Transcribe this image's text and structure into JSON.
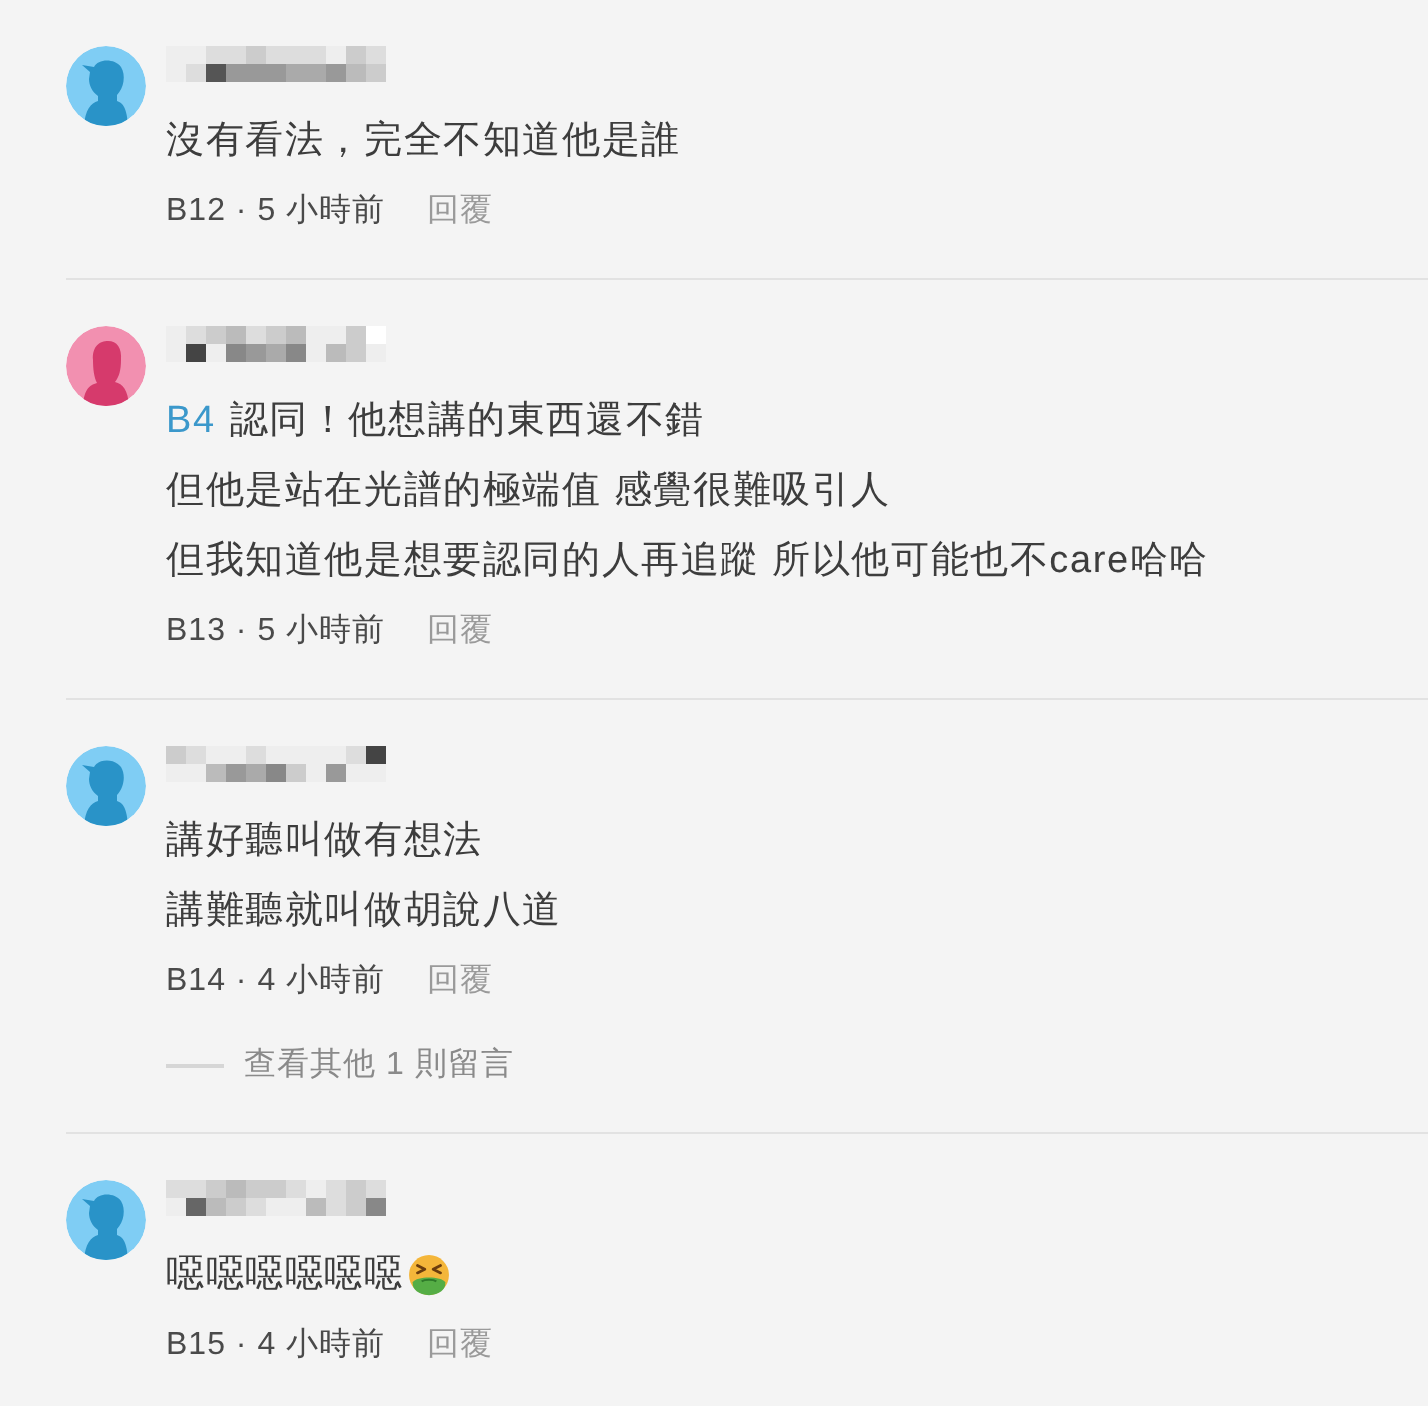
{
  "comments": [
    {
      "avatar": {
        "kind": "short-hair"
      },
      "lines": [
        "沒有看法，完全不知道他是誰"
      ],
      "meta": "B12 · 5 小時前",
      "reply": "回覆"
    },
    {
      "avatar": {
        "kind": "long-hair"
      },
      "mention": "B4",
      "lines": [
        "認同！他想講的東西還不錯",
        "但他是站在光譜的極端值 感覺很難吸引人",
        "但我知道他是想要認同的人再追蹤 所以他可能也不care哈哈"
      ],
      "meta": "B13 · 5 小時前",
      "reply": "回覆"
    },
    {
      "avatar": {
        "kind": "short-hair"
      },
      "lines": [
        "講好聽叫做有想法",
        "講難聽就叫做胡說八道"
      ],
      "meta": "B14 · 4 小時前",
      "reply": "回覆",
      "more_replies": "查看其他 1 則留言"
    },
    {
      "avatar": {
        "kind": "short-hair"
      },
      "lines": [
        "噁噁噁噁噁噁"
      ],
      "emoji": {
        "kind": "vomiting-face"
      },
      "meta": "B15 · 4 小時前",
      "reply": "回覆"
    }
  ]
}
